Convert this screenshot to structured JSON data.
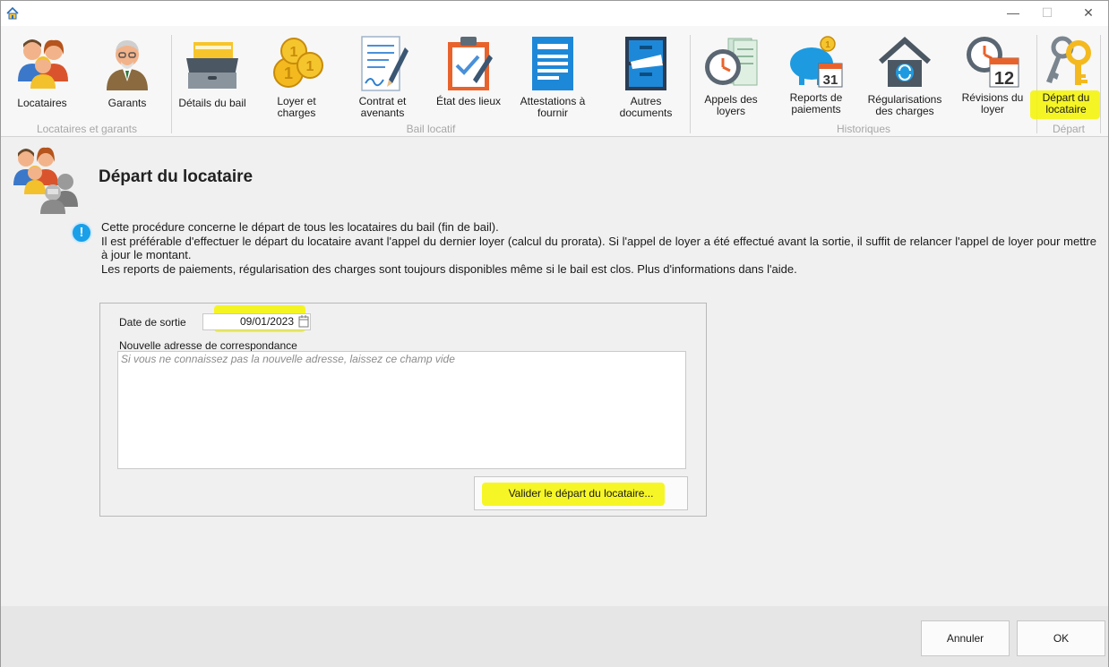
{
  "window": {
    "minimize": "—",
    "maximize": "☐",
    "close": "✕"
  },
  "ribbon": {
    "buttons": [
      {
        "id": "locataires",
        "label": "Locataires"
      },
      {
        "id": "garants",
        "label": "Garants"
      },
      {
        "id": "details_bail",
        "label": "Détails du bail"
      },
      {
        "id": "loyer_charges",
        "label": "Loyer et\ncharges"
      },
      {
        "id": "contrat",
        "label": "Contrat et\navenants"
      },
      {
        "id": "etat_lieux",
        "label": "État des lieux"
      },
      {
        "id": "attestations",
        "label": "Attestations à\nfournir"
      },
      {
        "id": "autres_docs",
        "label": "Autres\ndocuments"
      },
      {
        "id": "appels",
        "label": "Appels des\nloyers"
      },
      {
        "id": "reports",
        "label": "Reports de\npaiements"
      },
      {
        "id": "regularisations",
        "label": "Régularisations\ndes charges"
      },
      {
        "id": "revisions",
        "label": "Révisions du\nloyer"
      },
      {
        "id": "depart",
        "label": "Départ du\nlocataire"
      }
    ],
    "groups": [
      {
        "label": "Locataires et garants"
      },
      {
        "label": "Bail locatif"
      },
      {
        "label": "Historiques"
      },
      {
        "label": "Départ"
      }
    ],
    "calendar_day": "31",
    "calendar_day2": "12"
  },
  "page": {
    "title": "Départ du locataire",
    "info_lines": [
      "Cette procédure concerne le départ de tous les locataires du bail (fin de bail).",
      "Il est préférable d'effectuer le départ du locataire avant l'appel du dernier loyer (calcul du prorata). Si l'appel de loyer a été effectué avant la sortie, il suffit de relancer l'appel de loyer pour mettre à jour le montant.",
      "Les reports de paiements, régularisation des charges sont toujours disponibles même si le bail est clos. Plus d'informations dans l'aide."
    ]
  },
  "form": {
    "date_label": "Date de sortie",
    "date_value": "09/01/2023",
    "address_label": "Nouvelle adresse de correspondance",
    "address_placeholder": "Si vous ne connaissez pas la nouvelle adresse, laissez ce champ vide",
    "address_value": "",
    "validate_button": "Valider le départ du locataire..."
  },
  "footer": {
    "cancel": "Annuler",
    "ok": "OK"
  },
  "colors": {
    "highlight": "#f5f500",
    "info_blue": "#1aa0e8"
  }
}
